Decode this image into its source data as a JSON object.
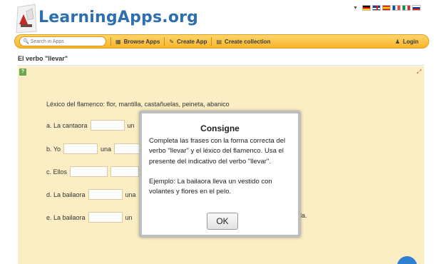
{
  "header": {
    "logo_text": "LearningApps.org",
    "languages": [
      "de",
      "gb",
      "es",
      "fr",
      "it",
      "ru"
    ]
  },
  "nav": {
    "search_placeholder": "Search in Apps",
    "browse": "Browse Apps",
    "create": "Create App",
    "collection": "Create collection",
    "login": "Login"
  },
  "page": {
    "title": "El verbo \"llevar\""
  },
  "exercise": {
    "vocab": "Léxico del flamenco: flor, mantilla, castañuelas, peineta, abanico",
    "rows": [
      {
        "label": "a. La cantaora",
        "after": "un"
      },
      {
        "label": "b. Yo",
        "after": "una"
      },
      {
        "label": "c. Ellos",
        "after": ""
      },
      {
        "label": "d. La bailaora",
        "after": "una"
      },
      {
        "label": "e. La bailaora",
        "after": "un",
        "trail": "ila."
      }
    ]
  },
  "dialog": {
    "title": "Consigne",
    "para1": "Completa las frases con la forma correcta del verbo \"llevar\" y el léxico del flamenco. Usa el presente del indicativo del verbo \"llevar\".",
    "para2": "Ejemplo: La bailaora lleva un vestido con volantes y flores en el pelo.",
    "ok": "OK"
  },
  "colors": {
    "navbar": "#f6b52b",
    "logo": "#2e6fb0",
    "app_bg": "#fbeec4"
  }
}
